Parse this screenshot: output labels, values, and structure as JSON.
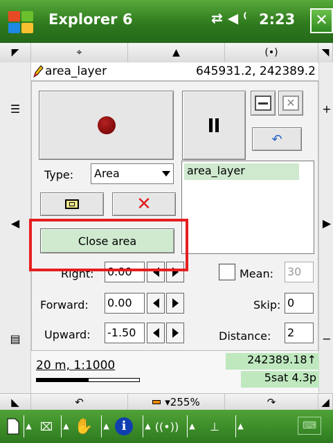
{
  "titlebar": {
    "app_title": "Explorer 6",
    "time": "2:23",
    "status_icons": "⇄ ◀ ⁽",
    "close_label": "✕"
  },
  "top_strip": {
    "left_arrow": "◤",
    "pan_icon": "⌖",
    "up_arrow": "▲",
    "gps_icon": "(•)",
    "right_arrow": "◥"
  },
  "layer_row": {
    "name": "area_layer",
    "coords": "645931.2, 242389.2"
  },
  "panel": {
    "type_label": "Type:",
    "type_value": "Area",
    "layer_list_item": "area_layer",
    "delete_label": "✕",
    "close_area_label": "Close area",
    "undo_label": "↶",
    "right_label": "Right:",
    "right_value": "0.00",
    "forward_label": "Forward:",
    "forward_value": "0.00",
    "upward_label": "Upward:",
    "upward_value": "-1.50",
    "mean_label": "Mean:",
    "mean_value": "30",
    "skip_label": "Skip:",
    "skip_value": "0",
    "distance_label": "Distance:",
    "distance_value": "2"
  },
  "status": {
    "scale": "20 m, 1:1000",
    "gps_coord": "242389.18↑",
    "gps_sat": "5sat 4.3p"
  },
  "bottom_strip": {
    "back_label": "↶",
    "zoom_label": "▾255%",
    "forward_label": "↷"
  },
  "colors": {
    "titlebar_green": "#2f7a1e",
    "highlight_red": "#e61f1f",
    "selection_green": "#cfe9cf"
  }
}
